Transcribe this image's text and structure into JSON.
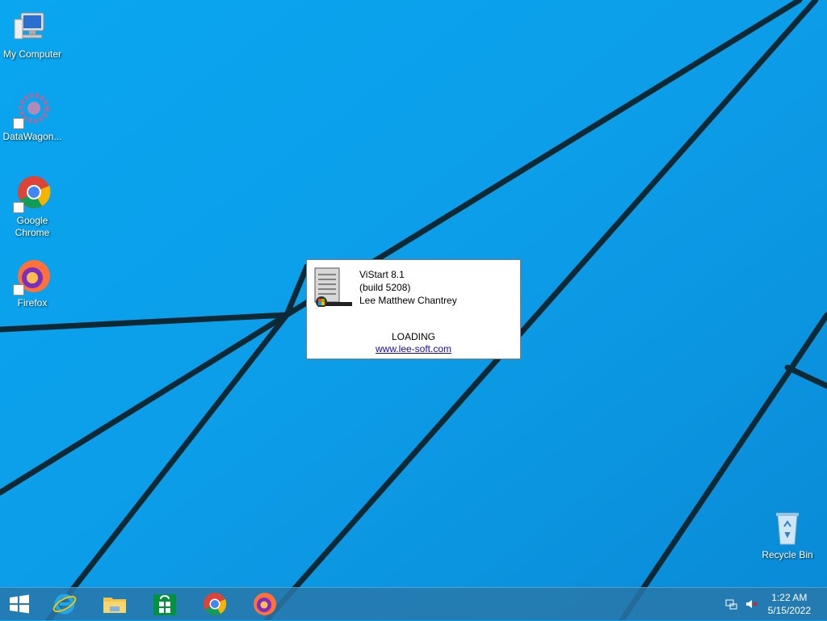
{
  "desktop": {
    "icons": [
      {
        "label": "My Computer"
      },
      {
        "label": "DataWagon..."
      },
      {
        "label": "Google Chrome",
        "line1": "Google",
        "line2": "Chrome"
      },
      {
        "label": "Firefox"
      },
      {
        "label": "Recycle Bin"
      }
    ]
  },
  "dialog": {
    "app_name": "ViStart 8.1",
    "build": "(build 5208)",
    "author": "Lee Matthew Chantrey",
    "status": "LOADING",
    "link": "www.lee-soft.com"
  },
  "taskbar": {
    "items": [
      "start-button",
      "internet-explorer",
      "file-explorer",
      "windows-store",
      "google-chrome",
      "firefox"
    ],
    "clock": {
      "time": "1:22 AM",
      "date": "5/15/2022"
    }
  },
  "colors": {
    "wallpaper": "#0a9fe8",
    "wallpaper_lines": "#0b2430",
    "taskbar": "#2a7aa8",
    "link": "#1a0dab"
  }
}
